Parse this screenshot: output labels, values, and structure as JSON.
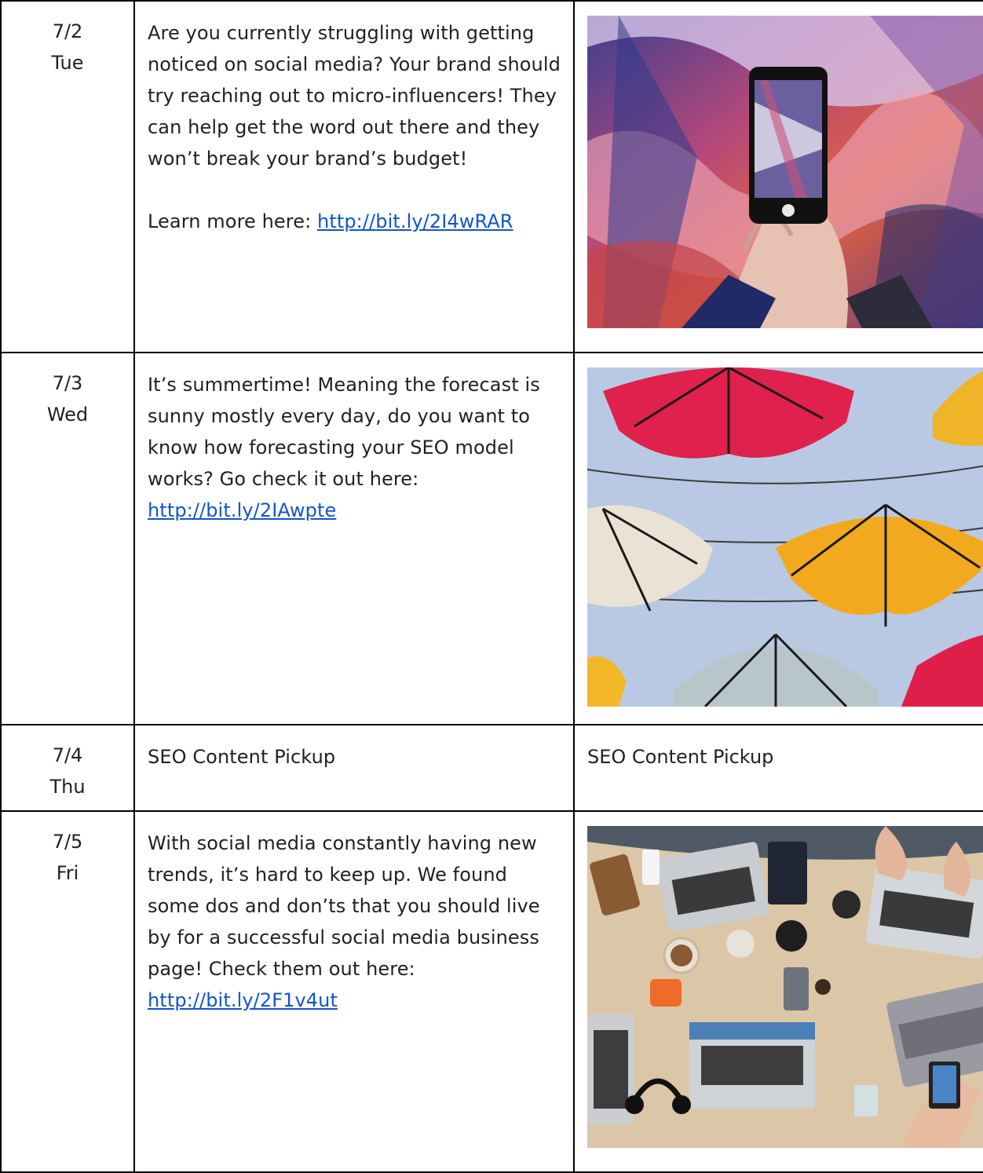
{
  "rows": [
    {
      "date": "7/2",
      "weekday": "Tue",
      "paragraphs": [
        "Are you currently struggling with getting noticed on social media? Your brand should try reaching out to micro-influencers! They can help get the word out there and they won’t break your brand’s budget!"
      ],
      "learn_more_prefix": "Learn more here: ",
      "link": "http://bit.ly/2I4wRAR",
      "image_icon": "phone-photo-graffiti-image"
    },
    {
      "date": "7/3",
      "weekday": "Wed",
      "text_prefix": "It’s summertime! Meaning the forecast is sunny mostly every day, do you want to know how forecasting your SEO model works? Go check it out here: ",
      "link": "http://bit.ly/2IAwpte",
      "image_icon": "umbrellas-image"
    },
    {
      "date": "7/4",
      "weekday": "Thu",
      "message": "SEO Content Pickup",
      "media_text": "SEO Content Pickup"
    },
    {
      "date": "7/5",
      "weekday": "Fri",
      "text_prefix": "With social media constantly having new trends, it’s hard to keep up. We found some dos and don’ts that you should live by for a successful social media business page! Check them out here: ",
      "link": "http://bit.ly/2F1v4ut",
      "image_icon": "desk-laptops-image"
    }
  ],
  "colors": {
    "link": "#1155cc",
    "border": "#000000",
    "text": "#202124"
  }
}
